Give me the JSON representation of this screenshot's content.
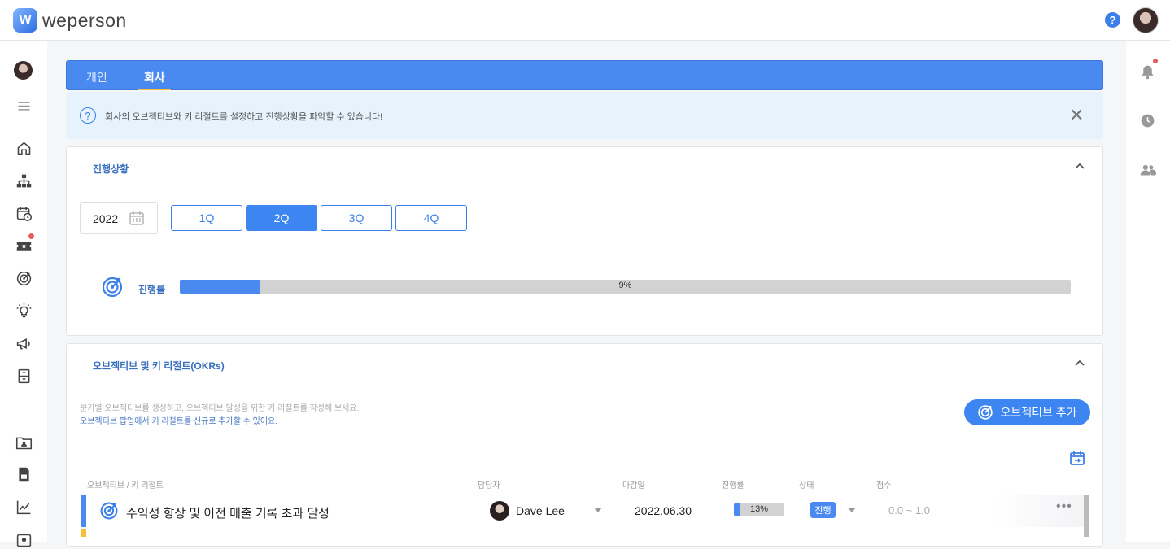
{
  "app": {
    "name": "weperson"
  },
  "header": {
    "help_icon": "?",
    "avatar": "user-avatar"
  },
  "tabs": [
    {
      "label": "개인",
      "active": false
    },
    {
      "label": "회사",
      "active": true
    }
  ],
  "banner": {
    "text": "회사의 오브젝티브와 키 리절트를 설정하고 진행상황을 파악할 수 있습니다!",
    "close": "✕"
  },
  "progress_section": {
    "title": "진행상황",
    "year": "2022",
    "quarters": [
      {
        "label": "1Q",
        "active": false
      },
      {
        "label": "2Q",
        "active": true
      },
      {
        "label": "3Q",
        "active": false
      },
      {
        "label": "4Q",
        "active": false
      }
    ],
    "progress_label": "진행률",
    "progress_value": 9,
    "progress_text": "9%"
  },
  "okr_section": {
    "title": "오브젝티브 및 키 리절트(OKRs)",
    "desc_line1": "분기별 오브젝티브를 생성하고, 오브젝티브 달성을 위한 키 리절트를 작성해 보세요.",
    "desc_line2": "오브젝티브 팝업에서 키 리절트를 신규로 추가할 수 있어요.",
    "add_button": "오브젝티브 추가",
    "columns": {
      "objective": "오브젝티브 / 키 리절트",
      "owner": "담당자",
      "due": "마감일",
      "progress": "진행률",
      "status": "상태",
      "score": "점수"
    },
    "rows": [
      {
        "title": "수익성 향상 및 이전 매출 기록 초과 달성",
        "owner": "Dave Lee",
        "due": "2022.06.30",
        "progress_value": 13,
        "progress_text": "13%",
        "status": "진행",
        "score": "0.0 ~ 1.0",
        "more": "•••"
      }
    ]
  },
  "colors": {
    "primary": "#4a8af0",
    "accent": "#f5c037",
    "banner_bg": "#e6f3fd"
  }
}
